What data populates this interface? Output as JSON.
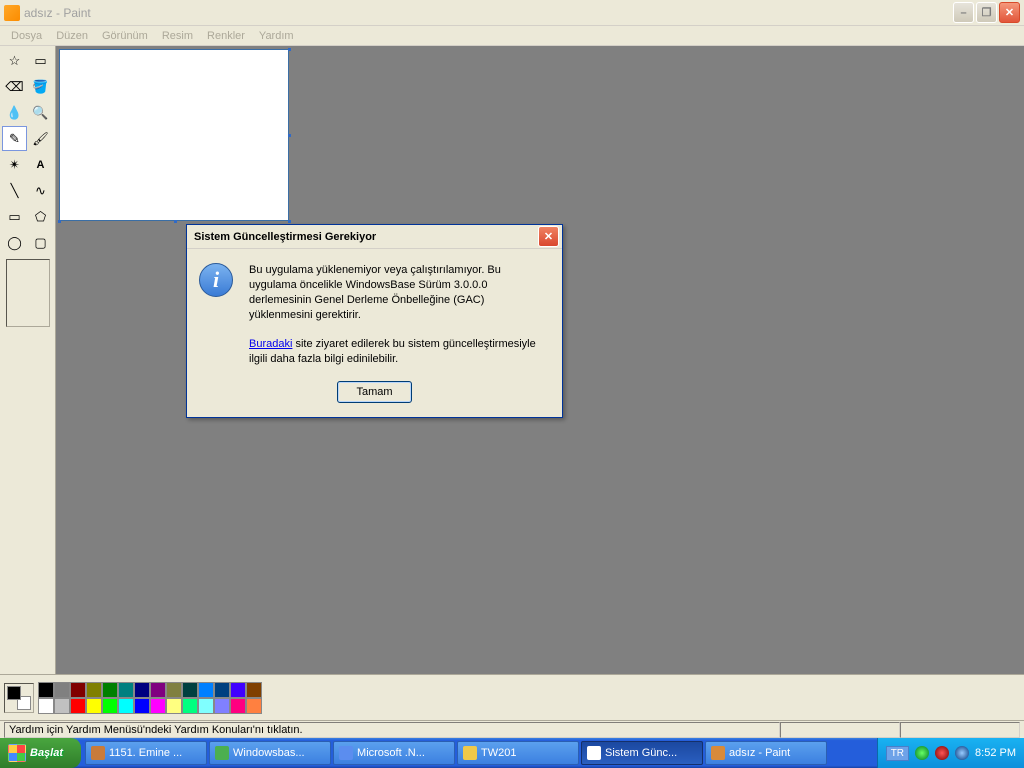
{
  "window": {
    "title": "adsız - Paint"
  },
  "menu": {
    "file": "Dosya",
    "edit": "Düzen",
    "view": "Görünüm",
    "image": "Resim",
    "colors": "Renkler",
    "help": "Yardım"
  },
  "dialog": {
    "title": "Sistem Güncelleştirmesi Gerekiyor",
    "body1": "Bu uygulama yüklenemiyor veya çalıştırılamıyor. Bu uygulama öncelikle WindowsBase Sürüm 3.0.0.0 derlemesinin Genel Derleme Önbelleğine (GAC) yüklenmesini gerektirir.",
    "link": "Buradaki",
    "body2": " site ziyaret edilerek bu sistem güncelleştirmesiyle ilgili daha fazla bilgi edinilebilir.",
    "ok": "Tamam"
  },
  "status": {
    "help": "Yardım için Yardım Menüsü'ndeki Yardım Konuları'nı tıklatın."
  },
  "palette": {
    "row1": [
      "#000000",
      "#808080",
      "#800000",
      "#808000",
      "#008000",
      "#008080",
      "#000080",
      "#800080",
      "#808040",
      "#004040",
      "#0080ff",
      "#004080",
      "#4000ff",
      "#804000"
    ],
    "row2": [
      "#ffffff",
      "#c0c0c0",
      "#ff0000",
      "#ffff00",
      "#00ff00",
      "#00ffff",
      "#0000ff",
      "#ff00ff",
      "#ffff80",
      "#00ff80",
      "#80ffff",
      "#8080ff",
      "#ff0080",
      "#ff8040"
    ]
  },
  "taskbar": {
    "start": "Başlat",
    "items": [
      {
        "label": "1151. Emine ...",
        "icon": "#c97b3a"
      },
      {
        "label": "Windowsbas...",
        "icon": "#4caf50"
      },
      {
        "label": "Microsoft .N...",
        "icon": "#5b8def"
      },
      {
        "label": "TW201",
        "icon": "#f0c94a"
      },
      {
        "label": "Sistem Günc...",
        "icon": "#ffffff",
        "active": true
      },
      {
        "label": "adsız - Paint",
        "icon": "#d88a3a"
      }
    ],
    "lang": "TR",
    "clock": "8:52 PM"
  }
}
